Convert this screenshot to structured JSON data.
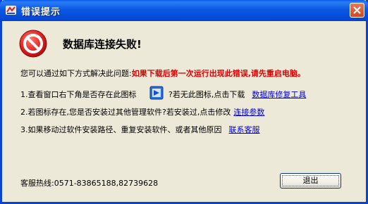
{
  "window": {
    "title": "错误提示"
  },
  "headline": "数据库连接失败!",
  "intro": {
    "text": "您可以通过如下方式解决此问题:",
    "highlight": "如果下载后第一次运行出现此错误,请先重启电脑。"
  },
  "steps": [
    {
      "before": "1.查看窗口右下角是否存在此图标",
      "after": "?若无此图标,点击下载",
      "link": "数据库修复工具"
    },
    {
      "before": "2.若图标存在,您是否安装过其他管理软件?若安装过,点击修改",
      "link": "连接参数"
    },
    {
      "before": "3.如果移动过软件安装路径、重复安装软件、或者其他原因",
      "link": "联系客服"
    }
  ],
  "hotline": "客服热线:0571-83865188,82739628",
  "buttons": {
    "exit": "退出"
  },
  "icons": {
    "app": "app-logo-icon",
    "error": "error-stop-icon",
    "tray": "tray-database-icon",
    "close": "close-icon"
  },
  "colors": {
    "titlebar": "#0a58e2",
    "highlight": "#e00000",
    "link": "#0000ee",
    "error_icon": "#d81c1c"
  }
}
